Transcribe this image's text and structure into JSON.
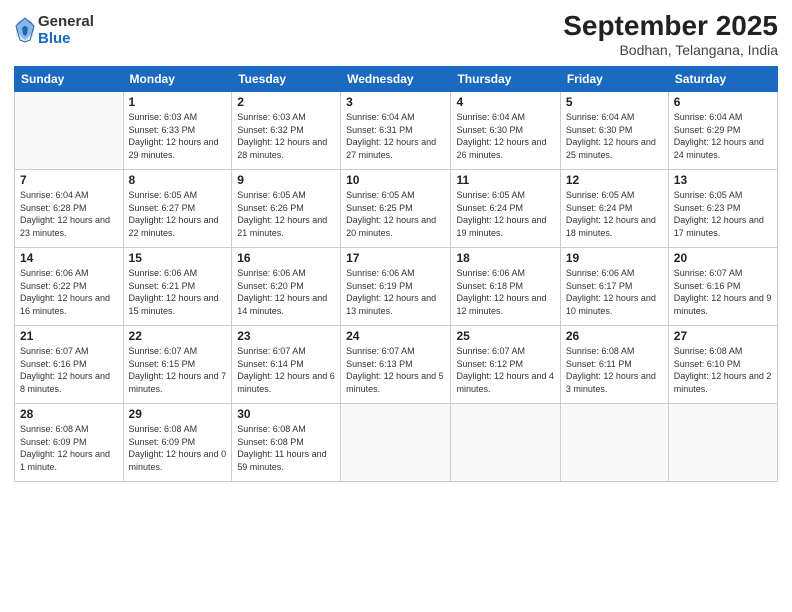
{
  "header": {
    "logo": {
      "general": "General",
      "blue": "Blue"
    },
    "title": "September 2025",
    "subtitle": "Bodhan, Telangana, India"
  },
  "days_of_week": [
    "Sunday",
    "Monday",
    "Tuesday",
    "Wednesday",
    "Thursday",
    "Friday",
    "Saturday"
  ],
  "weeks": [
    [
      {
        "day": "",
        "empty": true
      },
      {
        "day": "1",
        "sunrise": "6:03 AM",
        "sunset": "6:33 PM",
        "daylight": "12 hours and 29 minutes."
      },
      {
        "day": "2",
        "sunrise": "6:03 AM",
        "sunset": "6:32 PM",
        "daylight": "12 hours and 28 minutes."
      },
      {
        "day": "3",
        "sunrise": "6:04 AM",
        "sunset": "6:31 PM",
        "daylight": "12 hours and 27 minutes."
      },
      {
        "day": "4",
        "sunrise": "6:04 AM",
        "sunset": "6:30 PM",
        "daylight": "12 hours and 26 minutes."
      },
      {
        "day": "5",
        "sunrise": "6:04 AM",
        "sunset": "6:30 PM",
        "daylight": "12 hours and 25 minutes."
      },
      {
        "day": "6",
        "sunrise": "6:04 AM",
        "sunset": "6:29 PM",
        "daylight": "12 hours and 24 minutes."
      }
    ],
    [
      {
        "day": "7",
        "sunrise": "6:04 AM",
        "sunset": "6:28 PM",
        "daylight": "12 hours and 23 minutes."
      },
      {
        "day": "8",
        "sunrise": "6:05 AM",
        "sunset": "6:27 PM",
        "daylight": "12 hours and 22 minutes."
      },
      {
        "day": "9",
        "sunrise": "6:05 AM",
        "sunset": "6:26 PM",
        "daylight": "12 hours and 21 minutes."
      },
      {
        "day": "10",
        "sunrise": "6:05 AM",
        "sunset": "6:25 PM",
        "daylight": "12 hours and 20 minutes."
      },
      {
        "day": "11",
        "sunrise": "6:05 AM",
        "sunset": "6:24 PM",
        "daylight": "12 hours and 19 minutes."
      },
      {
        "day": "12",
        "sunrise": "6:05 AM",
        "sunset": "6:24 PM",
        "daylight": "12 hours and 18 minutes."
      },
      {
        "day": "13",
        "sunrise": "6:05 AM",
        "sunset": "6:23 PM",
        "daylight": "12 hours and 17 minutes."
      }
    ],
    [
      {
        "day": "14",
        "sunrise": "6:06 AM",
        "sunset": "6:22 PM",
        "daylight": "12 hours and 16 minutes."
      },
      {
        "day": "15",
        "sunrise": "6:06 AM",
        "sunset": "6:21 PM",
        "daylight": "12 hours and 15 minutes."
      },
      {
        "day": "16",
        "sunrise": "6:06 AM",
        "sunset": "6:20 PM",
        "daylight": "12 hours and 14 minutes."
      },
      {
        "day": "17",
        "sunrise": "6:06 AM",
        "sunset": "6:19 PM",
        "daylight": "12 hours and 13 minutes."
      },
      {
        "day": "18",
        "sunrise": "6:06 AM",
        "sunset": "6:18 PM",
        "daylight": "12 hours and 12 minutes."
      },
      {
        "day": "19",
        "sunrise": "6:06 AM",
        "sunset": "6:17 PM",
        "daylight": "12 hours and 10 minutes."
      },
      {
        "day": "20",
        "sunrise": "6:07 AM",
        "sunset": "6:16 PM",
        "daylight": "12 hours and 9 minutes."
      }
    ],
    [
      {
        "day": "21",
        "sunrise": "6:07 AM",
        "sunset": "6:16 PM",
        "daylight": "12 hours and 8 minutes."
      },
      {
        "day": "22",
        "sunrise": "6:07 AM",
        "sunset": "6:15 PM",
        "daylight": "12 hours and 7 minutes."
      },
      {
        "day": "23",
        "sunrise": "6:07 AM",
        "sunset": "6:14 PM",
        "daylight": "12 hours and 6 minutes."
      },
      {
        "day": "24",
        "sunrise": "6:07 AM",
        "sunset": "6:13 PM",
        "daylight": "12 hours and 5 minutes."
      },
      {
        "day": "25",
        "sunrise": "6:07 AM",
        "sunset": "6:12 PM",
        "daylight": "12 hours and 4 minutes."
      },
      {
        "day": "26",
        "sunrise": "6:08 AM",
        "sunset": "6:11 PM",
        "daylight": "12 hours and 3 minutes."
      },
      {
        "day": "27",
        "sunrise": "6:08 AM",
        "sunset": "6:10 PM",
        "daylight": "12 hours and 2 minutes."
      }
    ],
    [
      {
        "day": "28",
        "sunrise": "6:08 AM",
        "sunset": "6:09 PM",
        "daylight": "12 hours and 1 minute."
      },
      {
        "day": "29",
        "sunrise": "6:08 AM",
        "sunset": "6:09 PM",
        "daylight": "12 hours and 0 minutes."
      },
      {
        "day": "30",
        "sunrise": "6:08 AM",
        "sunset": "6:08 PM",
        "daylight": "11 hours and 59 minutes."
      },
      {
        "day": "",
        "empty": true
      },
      {
        "day": "",
        "empty": true
      },
      {
        "day": "",
        "empty": true
      },
      {
        "day": "",
        "empty": true
      }
    ]
  ],
  "labels": {
    "sunrise": "Sunrise:",
    "sunset": "Sunset:",
    "daylight": "Daylight:"
  }
}
